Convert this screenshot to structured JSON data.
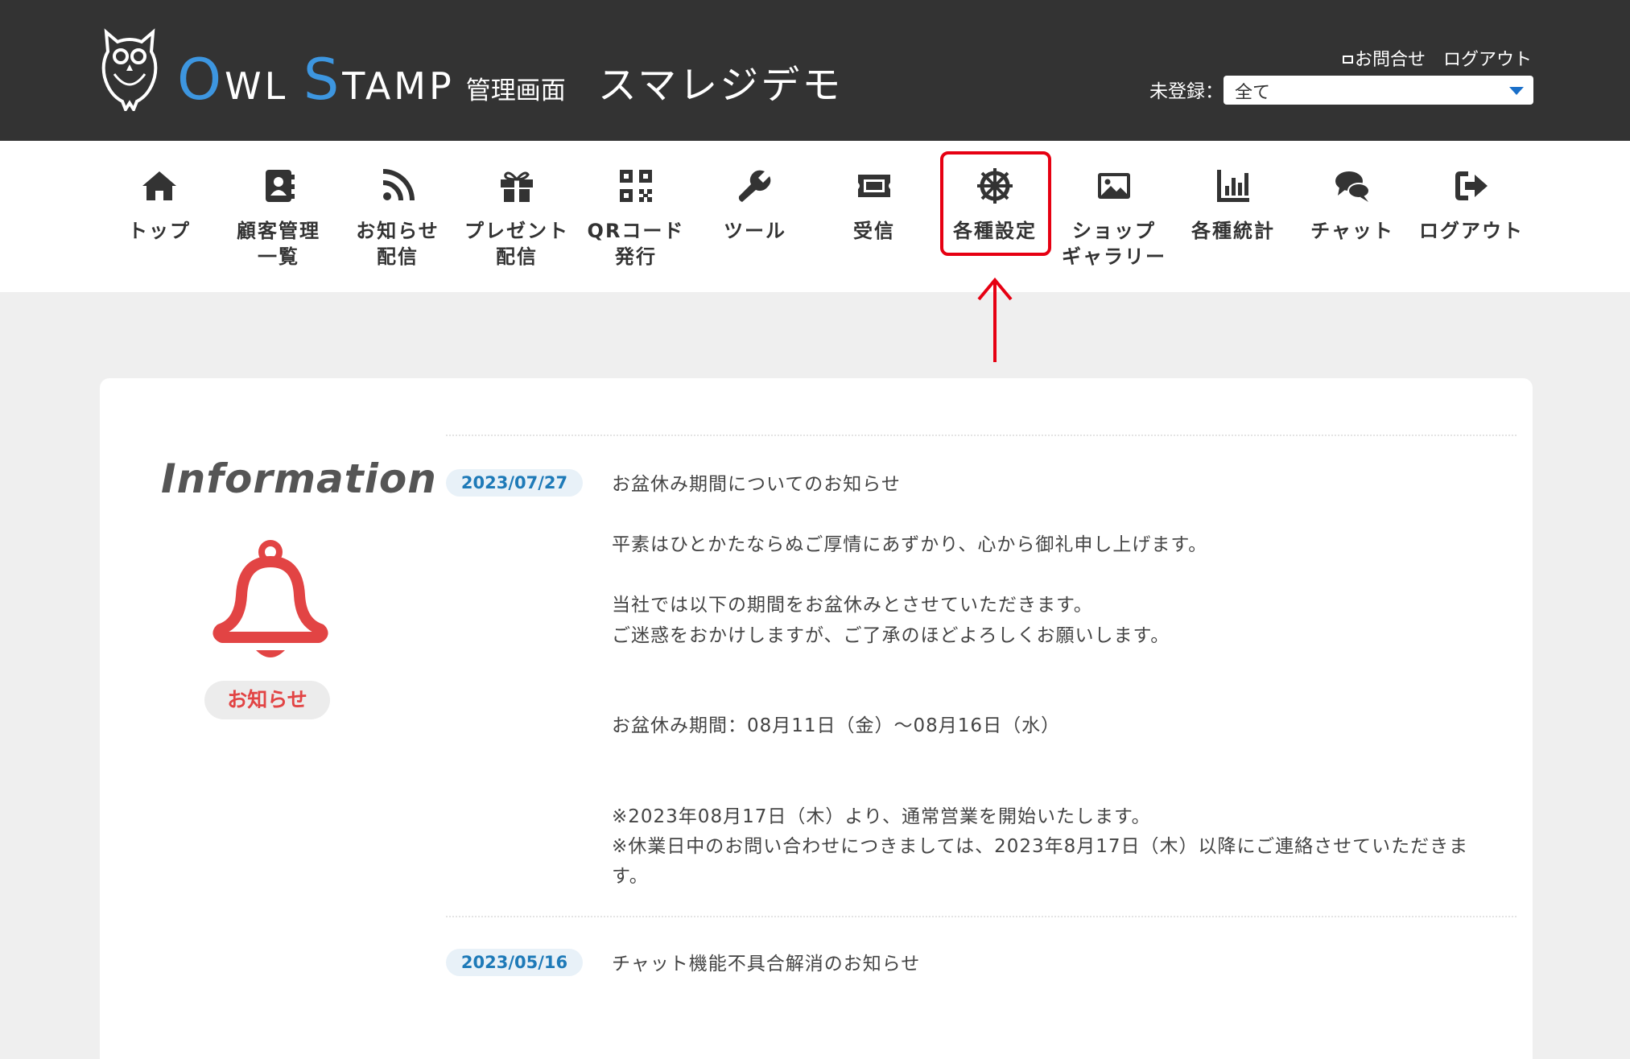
{
  "header": {
    "brand_letters": {
      "o": "O",
      "wl": "WL",
      "s": "S",
      "tamp": "TAMP"
    },
    "brand_subtitle": "管理画面",
    "shop_name": "スマレジデモ",
    "contact_link": "お問合せ",
    "logout_link": "ログアウト",
    "filter_label": "未登録：",
    "filter_selected": "全て"
  },
  "nav": {
    "items": [
      {
        "label": "トップ",
        "icon": "home-icon"
      },
      {
        "label": "顧客管理\n一覧",
        "icon": "contact-book-icon"
      },
      {
        "label": "お知らせ\n配信",
        "icon": "rss-icon"
      },
      {
        "label": "プレゼント\n配信",
        "icon": "gift-icon"
      },
      {
        "label": "QRコード\n発行",
        "icon": "qr-code-icon"
      },
      {
        "label": "ツール",
        "icon": "wrench-icon"
      },
      {
        "label": "受信",
        "icon": "ticket-icon"
      },
      {
        "label": "各種設定",
        "icon": "helm-icon"
      },
      {
        "label": "ショップ\nギャラリー",
        "icon": "image-icon"
      },
      {
        "label": "各種統計",
        "icon": "bar-chart-icon"
      },
      {
        "label": "チャット",
        "icon": "chat-bubbles-icon"
      },
      {
        "label": "ログアウト",
        "icon": "sign-out-icon"
      }
    ],
    "highlighted_item": "各種設定",
    "highlight_color": "#e60012"
  },
  "info": {
    "title": "Information",
    "badge_label": "お知らせ",
    "bell_color": "#e24444",
    "news": [
      {
        "date": "2023/07/27",
        "title": "お盆休み期間についてのお知らせ",
        "lines": [
          "平素はひとかたならぬご厚情にあずかり、心から御礼申し上げます。",
          "当社では以下の期間をお盆休みとさせていただきます。",
          "ご迷惑をおかけしますが、ご了承のほどよろしくお願いします。",
          "お盆休み期間：08月11日（金）～08月16日（水）",
          "※2023年08月17日（木）より、通常営業を開始いたします。",
          "※休業日中のお問い合わせにつきましては、2023年8月17日（木）以降にご連絡させていただきま",
          "す。"
        ]
      },
      {
        "date": "2023/05/16",
        "title": "チャット機能不具合解消のお知らせ"
      }
    ]
  },
  "colors": {
    "header_bg": "#333333",
    "brand_accent": "#3d96e0",
    "date_pill_text": "#1e7ab8"
  }
}
